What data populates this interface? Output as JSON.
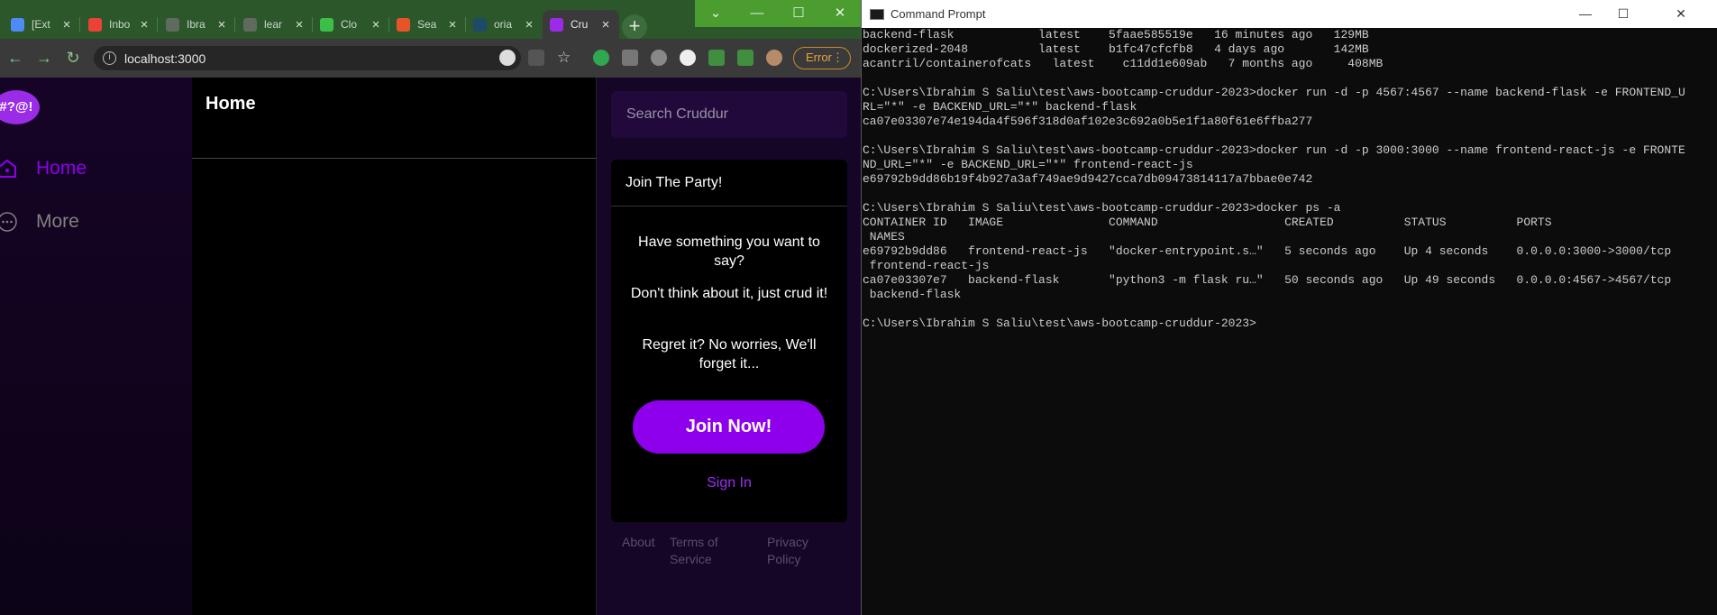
{
  "browser": {
    "tabs": [
      {
        "label": "[Ext",
        "favicon_color": "#4d8cf6"
      },
      {
        "label": "Inbo",
        "favicon_color": "#ea4335"
      },
      {
        "label": "Ibra",
        "favicon_color": "#5f6b5f"
      },
      {
        "label": "lear",
        "favicon_color": "#5f6b5f"
      },
      {
        "label": "Clo",
        "favicon_color": "#3bbf49"
      },
      {
        "label": "Sea",
        "favicon_color": "#e8532a"
      },
      {
        "label": "oria",
        "favicon_color": "#1e4a6a"
      },
      {
        "label": "Cru",
        "favicon_color": "#9a2be6"
      }
    ],
    "new_tab_glyph": "+",
    "window_buttons": {
      "menu": "⌄",
      "minimize": "—",
      "maximize": "☐",
      "close": "✕"
    },
    "nav": {
      "back": "←",
      "forward": "→",
      "reload": "↻"
    },
    "url": "localhost:3000",
    "error_label": "Error",
    "menu_glyph": "⋮"
  },
  "app": {
    "logo_text": "#?@!",
    "nav_items": [
      {
        "label": "Home",
        "active": true,
        "color": "#8e00ec"
      },
      {
        "label": "More",
        "active": false,
        "color": "#808080"
      }
    ],
    "feed_title": "Home",
    "search_placeholder": "Search Cruddur",
    "join_box": {
      "heading": "Join The Party!",
      "line1": "Have something you want to say?",
      "line2": "Don't think about it, just crud it!",
      "line3": "Regret it? No worries, We'll forget it...",
      "join_button": "Join Now!",
      "sign_in": "Sign In"
    },
    "footer": {
      "about": "About",
      "terms": "Terms of Service",
      "privacy": "Privacy Policy"
    }
  },
  "cmd": {
    "title": "Command Prompt",
    "window_buttons": {
      "minimize": "—",
      "maximize": "☐",
      "close": "✕"
    },
    "lines": [
      "backend-flask            latest    5faae585519e   16 minutes ago   129MB",
      "dockerized-2048          latest    b1fc47cfcfb8   4 days ago       142MB",
      "acantril/containerofcats   latest    c11dd1e609ab   7 months ago     408MB",
      "",
      "C:\\Users\\Ibrahim S Saliu\\test\\aws-bootcamp-cruddur-2023>docker run -d -p 4567:4567 --name backend-flask -e FRONTEND_U",
      "RL=\"*\" -e BACKEND_URL=\"*\" backend-flask",
      "ca07e03307e74e194da4f596f318d0af102e3c692a0b5e1f1a80f61e6ffba277",
      "",
      "C:\\Users\\Ibrahim S Saliu\\test\\aws-bootcamp-cruddur-2023>docker run -d -p 3000:3000 --name frontend-react-js -e FRONTE",
      "ND_URL=\"*\" -e BACKEND_URL=\"*\" frontend-react-js",
      "e69792b9dd86b19f4b927a3af749ae9d9427cca7db09473814117a7bbae0e742",
      "",
      "C:\\Users\\Ibrahim S Saliu\\test\\aws-bootcamp-cruddur-2023>docker ps -a",
      "CONTAINER ID   IMAGE               COMMAND                  CREATED          STATUS          PORTS",
      " NAMES",
      "e69792b9dd86   frontend-react-js   \"docker-entrypoint.s…\"   5 seconds ago    Up 4 seconds    0.0.0.0:3000->3000/tcp",
      " frontend-react-js",
      "ca07e03307e7   backend-flask       \"python3 -m flask ru…\"   50 seconds ago   Up 49 seconds   0.0.0.0:4567->4567/tcp",
      " backend-flask",
      "",
      "C:\\Users\\Ibrahim S Saliu\\test\\aws-bootcamp-cruddur-2023>"
    ]
  }
}
